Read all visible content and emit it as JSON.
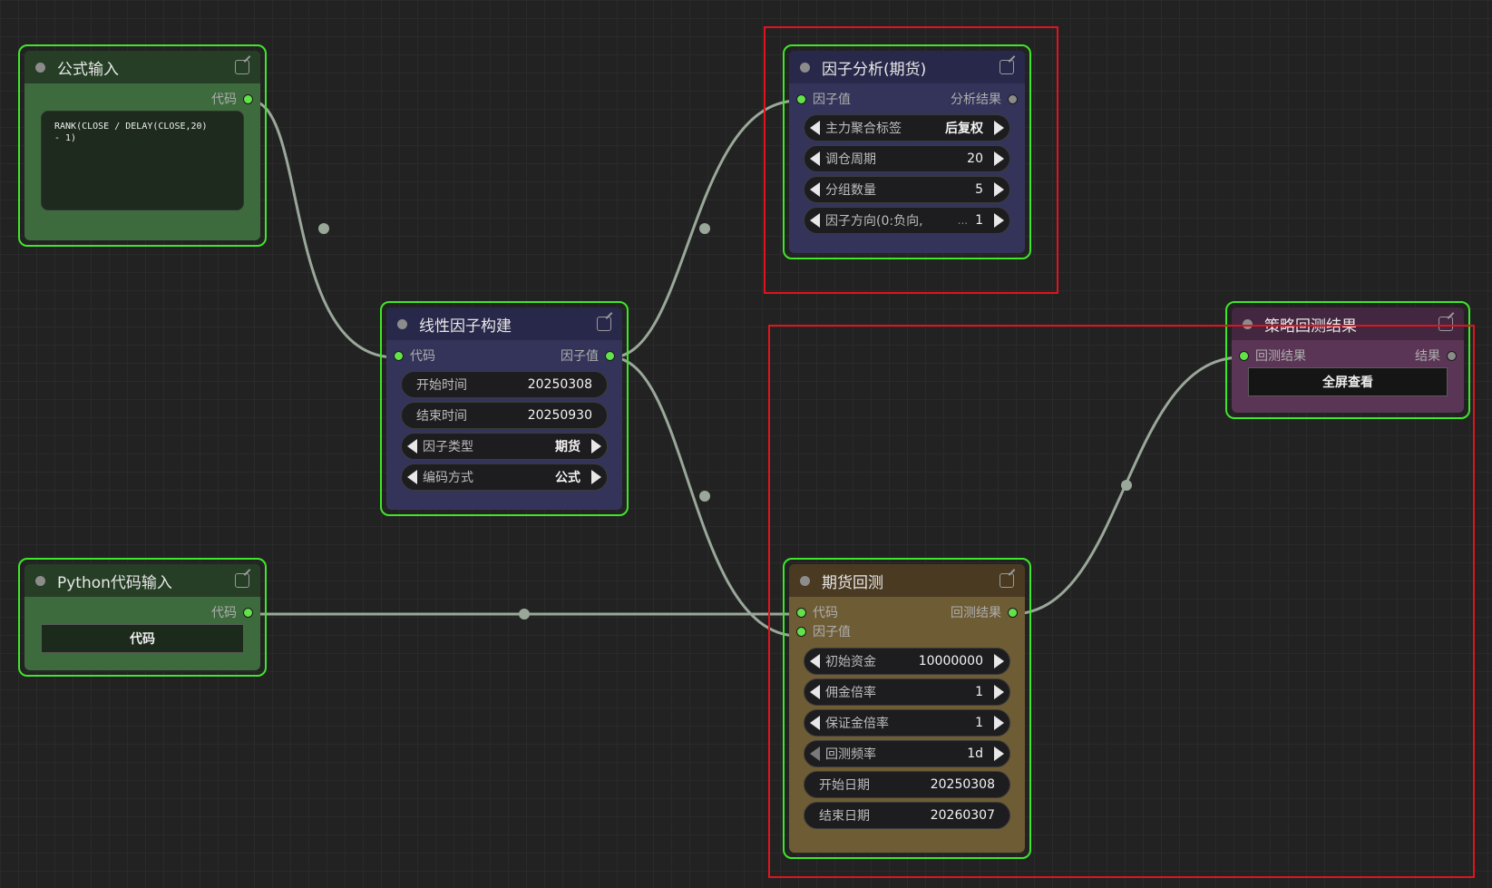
{
  "nodes": {
    "formula_input": {
      "title": "公式输入",
      "output": "代码",
      "code": "RANK(CLOSE / DELAY(CLOSE,20)\n- 1)"
    },
    "python_input": {
      "title": "Python代码输入",
      "output": "代码",
      "button": "代码"
    },
    "linear_factor": {
      "title": "线性因子构建",
      "input": "代码",
      "output": "因子值",
      "start_label": "开始时间",
      "start_value": "20250308",
      "end_label": "结束时间",
      "end_value": "20250930",
      "type_label": "因子类型",
      "type_value": "期货",
      "encode_label": "编码方式",
      "encode_value": "公式"
    },
    "factor_analysis": {
      "title": "因子分析(期货)",
      "input": "因子值",
      "output": "分析结果",
      "w1_label": "主力聚合标签",
      "w1_value": "后复权",
      "w2_label": "调仓周期",
      "w2_value": "20",
      "w3_label": "分组数量",
      "w3_value": "5",
      "w4_label": "因子方向(0:负向,",
      "w4_ellipsis": "...",
      "w4_value": "1"
    },
    "futures_backtest": {
      "title": "期货回测",
      "input1": "代码",
      "input2": "因子值",
      "output": "回测结果",
      "capital_label": "初始资金",
      "capital_value": "10000000",
      "commission_label": "佣金倍率",
      "commission_value": "1",
      "margin_label": "保证金倍率",
      "margin_value": "1",
      "freq_label": "回测频率",
      "freq_value": "1d",
      "start_label": "开始日期",
      "start_value": "20250308",
      "end_label": "结束日期",
      "end_value": "20260307"
    },
    "strategy_result": {
      "title": "策略回测结果",
      "input": "回测结果",
      "output": "结果",
      "button": "全屏查看"
    }
  },
  "colors": {
    "node_border": "#3fe62a",
    "link": "#9aa89a",
    "highlight": "#e3131b",
    "green_node": "#3e6b3e",
    "blue_node": "#34345a",
    "gold_node": "#6e5c35",
    "purple_node": "#5b3555"
  },
  "icons": [
    "status-dot-icon",
    "edit-icon",
    "arrow-left-icon",
    "arrow-right-icon"
  ]
}
